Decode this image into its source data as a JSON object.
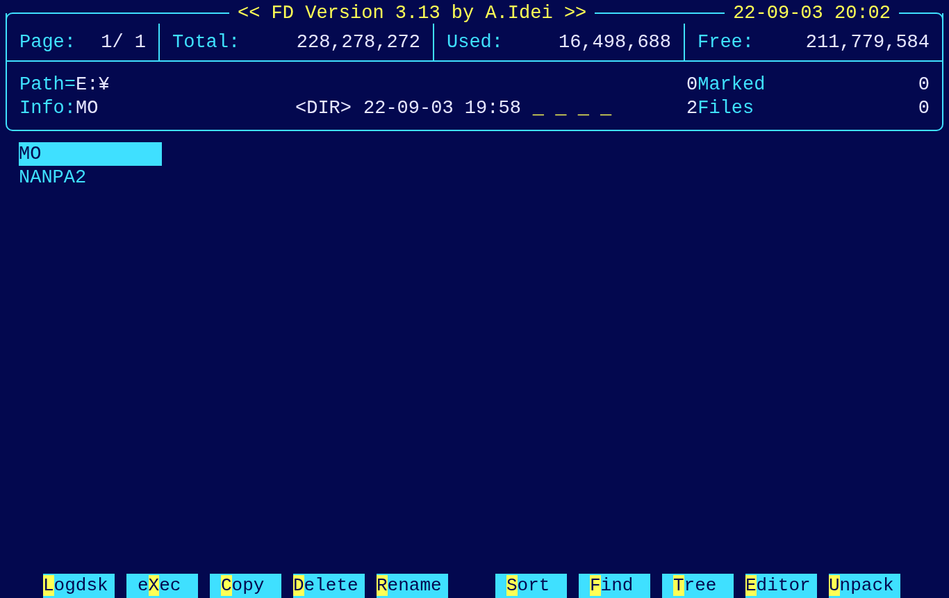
{
  "header": {
    "title": "<< FD Version 3.13 by A.Idei >>",
    "datetime": "22-09-03 20:02"
  },
  "stats": [
    {
      "label": "Page:",
      "value": "1/ 1"
    },
    {
      "label": "Total:",
      "value": "228,278,272"
    },
    {
      "label": "Used:",
      "value": "16,498,688"
    },
    {
      "label": "Free:",
      "value": "211,779,584"
    }
  ],
  "path": {
    "label": "Path=",
    "value": "E:¥"
  },
  "info": {
    "label": "Info:",
    "value": "MO",
    "type": "<DIR>",
    "date": "22-09-03 19:58",
    "attributes": "_ _ _ _"
  },
  "counts": [
    {
      "count": "0",
      "label": "Marked",
      "value": "0"
    },
    {
      "count": "2",
      "label": "Files",
      "value": "0"
    }
  ],
  "files": [
    {
      "name": "MO",
      "selected": true
    },
    {
      "name": "NANPA2",
      "selected": false
    }
  ],
  "function_keys": [
    [
      {
        "indented": false,
        "key": "L",
        "after": "ogdsk"
      },
      {
        "indented": true,
        "before": "e",
        "key": "X",
        "after": "ec"
      },
      {
        "indented": true,
        "key": "C",
        "after": "opy"
      },
      {
        "indented": false,
        "key": "D",
        "after": "elete"
      },
      {
        "indented": false,
        "key": "R",
        "after": "ename"
      }
    ],
    [
      {
        "indented": true,
        "key": "S",
        "after": "ort"
      },
      {
        "indented": true,
        "key": "F",
        "after": "ind"
      },
      {
        "indented": true,
        "key": "T",
        "after": "ree"
      },
      {
        "indented": false,
        "key": "E",
        "after": "ditor"
      },
      {
        "indented": false,
        "key": "U",
        "after": "npack"
      }
    ]
  ]
}
